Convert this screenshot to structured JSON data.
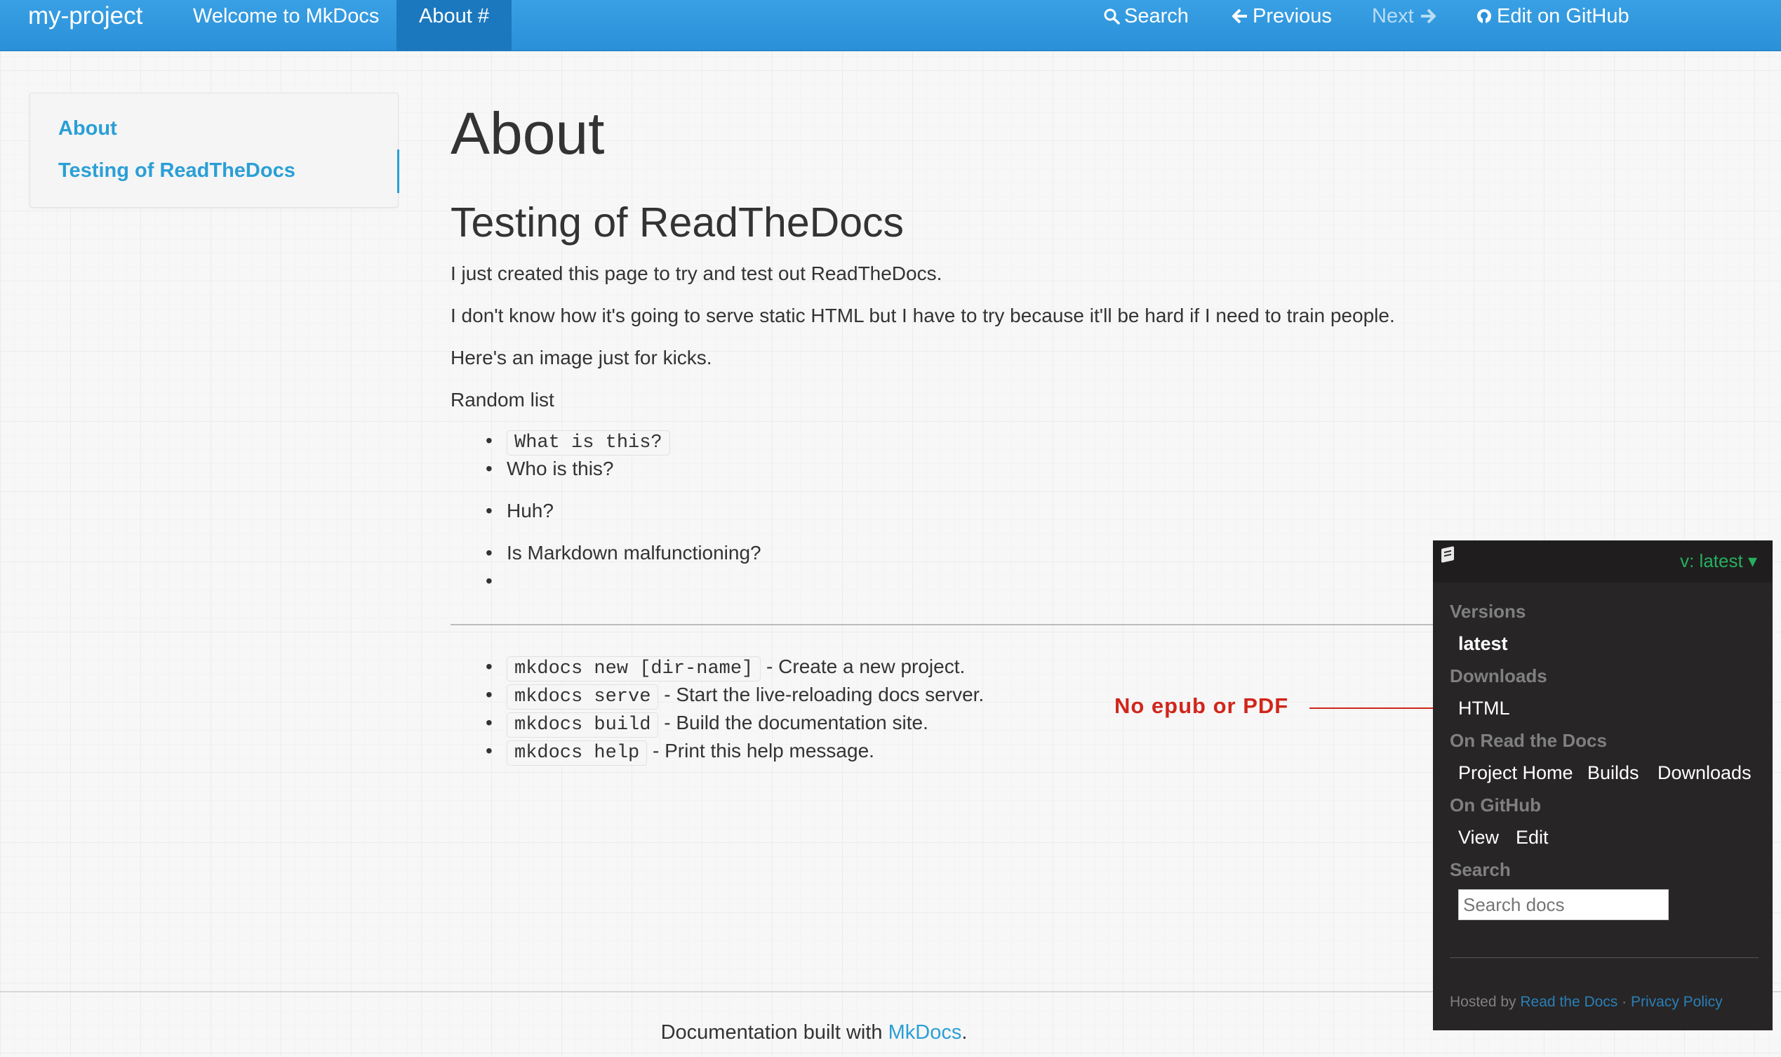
{
  "navbar": {
    "brand": "my-project",
    "links": [
      {
        "label": "Welcome to MkDocs"
      },
      {
        "label": "About #"
      }
    ],
    "search_label": "Search",
    "previous_label": "Previous",
    "next_label": "Next",
    "edit_label": "Edit on GitHub"
  },
  "sidebar": {
    "items": [
      "About",
      "Testing of ReadTheDocs"
    ]
  },
  "content": {
    "h1": "About",
    "h2": "Testing of ReadTheDocs",
    "p1": "I just created this page to try and test out ReadTheDocs.",
    "p2": "I don't know how it's going to serve static HTML but I have to try because it'll be hard if I need to train people.",
    "p3": "Here's an image just for kicks.",
    "p4": "Random list",
    "list1": {
      "code_item": "What is this?",
      "items": [
        "Who is this?",
        "Huh?",
        "Is Markdown malfunctioning?"
      ]
    },
    "list2": [
      {
        "code": "mkdocs new [dir-name]",
        "text": " - Create a new project."
      },
      {
        "code": "mkdocs serve",
        "text": " - Start the live-reloading docs server."
      },
      {
        "code": "mkdocs build",
        "text": " - Build the documentation site."
      },
      {
        "code": "mkdocs help",
        "text": " - Print this help message."
      }
    ]
  },
  "footer": {
    "prefix": "Documentation built with ",
    "link": "MkDocs",
    "suffix": "."
  },
  "annotation": {
    "text": "No epub or PDF",
    "color": "#d0261b"
  },
  "flyout": {
    "current_version": "v: latest",
    "versions_label": "Versions",
    "version_items": [
      "latest"
    ],
    "downloads_label": "Downloads",
    "download_items": [
      "HTML"
    ],
    "rtd_label": "On Read the Docs",
    "rtd_items": [
      "Project Home",
      "Builds",
      "Downloads"
    ],
    "github_label": "On GitHub",
    "github_items": [
      "View",
      "Edit"
    ],
    "search_label": "Search",
    "search_placeholder": "Search docs",
    "hosted_by": "Hosted by ",
    "rtd_link": "Read the Docs",
    "separator": " · ",
    "privacy_link": "Privacy Policy"
  },
  "colors": {
    "navbar": "#2a90d8",
    "link": "#2a9fd6",
    "flyout_bg": "#272525",
    "version_green": "#27ae60"
  }
}
